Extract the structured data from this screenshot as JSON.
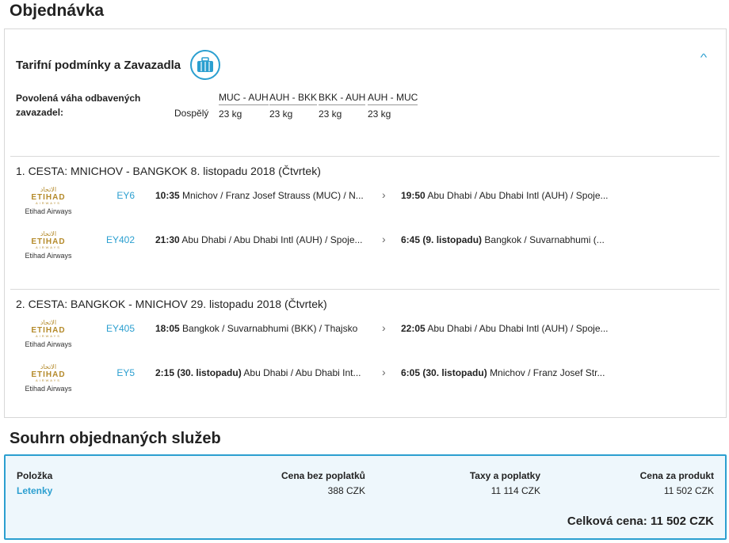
{
  "page_title": "Objednávka",
  "tariff": {
    "title": "Tarifní podmínky a Zavazadla",
    "icon": "luggage-icon",
    "baggage_label": "Povolená váha odbavených zavazadel:",
    "passenger_type": "Dospělý",
    "routes": [
      {
        "route": "MUC - AUH",
        "weight": "23 kg"
      },
      {
        "route": "AUH - BKK",
        "weight": "23 kg"
      },
      {
        "route": "BKK - AUH",
        "weight": "23 kg"
      },
      {
        "route": "AUH - MUC",
        "weight": "23 kg"
      }
    ]
  },
  "journeys": [
    {
      "title": "1. CESTA: MNICHOV - BANGKOK 8. listopadu 2018 (Čtvrtek)",
      "segments": [
        {
          "airline": "Etihad Airways",
          "flight": "EY6",
          "dep_time": "10:35",
          "dep_place": "Mnichov / Franz Josef Strauss (MUC) / N...",
          "arr_time": "19:50",
          "arr_note": "",
          "arr_place": "Abu Dhabi / Abu Dhabi Intl (AUH) / Spoje..."
        },
        {
          "airline": "Etihad Airways",
          "flight": "EY402",
          "dep_time": "21:30",
          "dep_place": "Abu Dhabi / Abu Dhabi Intl (AUH) / Spoje...",
          "arr_time": "6:45",
          "arr_note": "(9. listopadu)",
          "arr_place": "Bangkok / Suvarnabhumi (..."
        }
      ]
    },
    {
      "title": "2. CESTA: BANGKOK - MNICHOV 29. listopadu 2018 (Čtvrtek)",
      "segments": [
        {
          "airline": "Etihad Airways",
          "flight": "EY405",
          "dep_time": "18:05",
          "dep_note": "",
          "dep_place": "Bangkok / Suvarnabhumi (BKK) / Thajsko",
          "arr_time": "22:05",
          "arr_note": "",
          "arr_place": "Abu Dhabi / Abu Dhabi Intl (AUH) / Spoje..."
        },
        {
          "airline": "Etihad Airways",
          "flight": "EY5",
          "dep_time": "2:15",
          "dep_note": "(30. listopadu)",
          "dep_place": "Abu Dhabi / Abu Dhabi Int...",
          "arr_time": "6:05",
          "arr_note": "(30. listopadu)",
          "arr_place": "Mnichov / Franz Josef Str..."
        }
      ]
    }
  ],
  "airline_logo": {
    "arabic": "الاتحاد",
    "main": "ETIHAD",
    "sub": "AIRWAYS"
  },
  "summary": {
    "title": "Souhrn objednaných služeb",
    "headers": {
      "item": "Položka",
      "price": "Cena bez poplatků",
      "taxes": "Taxy a poplatky",
      "product": "Cena za produkt"
    },
    "row": {
      "item": "Letenky",
      "price": "388 CZK",
      "taxes": "11 114 CZK",
      "product": "11 502 CZK"
    },
    "total": "Celková cena: 11 502 CZK"
  },
  "colors": {
    "accent": "#2b9fd0",
    "logo_gold": "#b58b2c",
    "summary_bg": "#eef7fc"
  }
}
